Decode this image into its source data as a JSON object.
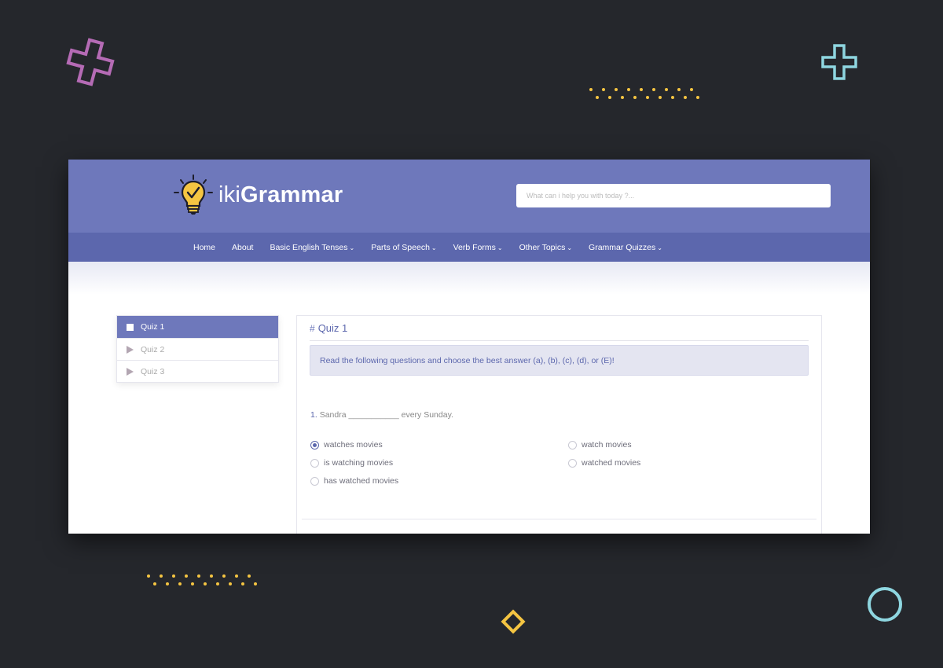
{
  "brand": {
    "logo_light": "iki",
    "logo_bold": "Grammar",
    "icon": "lightbulb-check-icon"
  },
  "search": {
    "placeholder": "What can i help you with today ?..."
  },
  "nav": {
    "items": [
      {
        "label": "Home",
        "dropdown": false
      },
      {
        "label": "About",
        "dropdown": false
      },
      {
        "label": "Basic English Tenses",
        "dropdown": true
      },
      {
        "label": "Parts of Speech",
        "dropdown": true
      },
      {
        "label": "Verb Forms",
        "dropdown": true
      },
      {
        "label": "Other Topics",
        "dropdown": true
      },
      {
        "label": "Grammar Quizzes",
        "dropdown": true
      }
    ]
  },
  "sidebar": {
    "items": [
      {
        "label": "Quiz 1",
        "active": true
      },
      {
        "label": "Quiz 2",
        "active": false
      },
      {
        "label": "Quiz 3",
        "active": false
      }
    ]
  },
  "quiz": {
    "title": "Quiz 1",
    "instructions": "Read the following questions and choose the best answer (a), (b), (c), (d), or (E)!",
    "question_number": "1.",
    "question_text": "Sandra ___________ every Sunday.",
    "options": [
      {
        "label": "watches movies",
        "checked": true
      },
      {
        "label": "watch movies",
        "checked": false
      },
      {
        "label": "is watching movies",
        "checked": false
      },
      {
        "label": "watched movies",
        "checked": false
      },
      {
        "label": "has watched movies",
        "checked": false
      }
    ]
  },
  "colors": {
    "topbar": "#6e78bb",
    "navbar": "#5c67ad",
    "background": "#25272c",
    "accent_yellow": "#f5c542",
    "accent_pink": "#b56bb5",
    "accent_teal": "#8ed6e0"
  }
}
